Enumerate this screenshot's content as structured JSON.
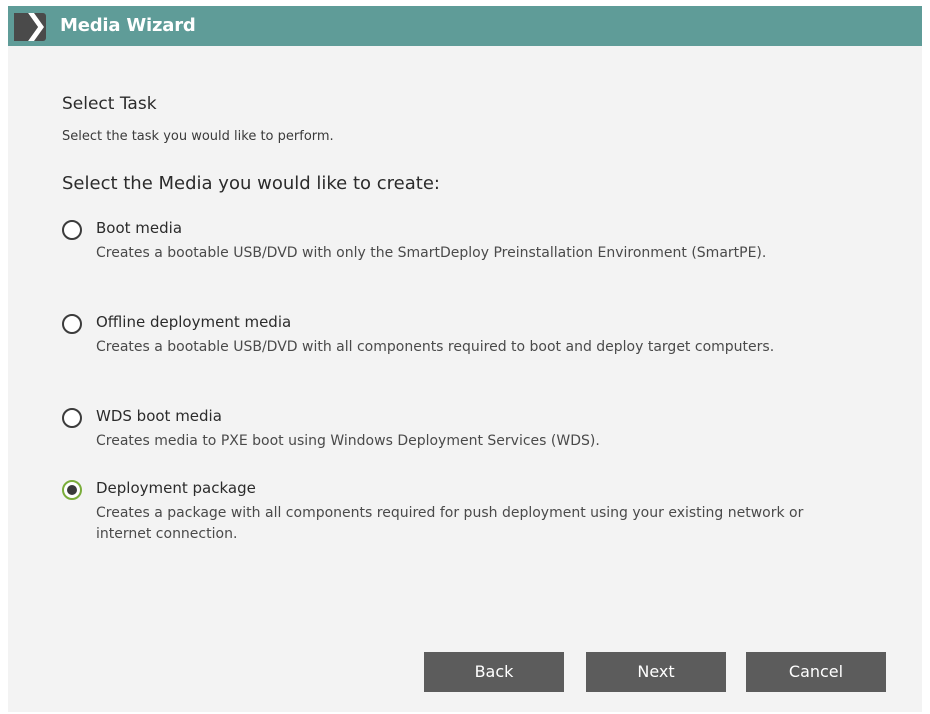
{
  "window": {
    "title": "Media Wizard",
    "logo_icon": "chevron-right-logo-icon"
  },
  "page": {
    "heading": "Select Task",
    "subheading": "Select the task you would like to perform.",
    "prompt": "Select the Media you would like to create:"
  },
  "options": [
    {
      "label": "Boot media",
      "description": "Creates a bootable USB/DVD with only the SmartDeploy Preinstallation Environment (SmartPE).",
      "selected": false
    },
    {
      "label": "Offline deployment media",
      "description": "Creates a bootable USB/DVD with all components required to boot and deploy target computers.",
      "selected": false
    },
    {
      "label": "WDS boot media",
      "description": "Creates media to PXE boot using Windows Deployment Services (WDS).",
      "selected": false
    },
    {
      "label": "Deployment package",
      "description": "Creates a package with all components required for push deployment using your existing network or internet connection.",
      "selected": true
    }
  ],
  "buttons": {
    "back": "Back",
    "next": "Next",
    "cancel": "Cancel"
  },
  "colors": {
    "titlebar": "#5f9c98",
    "button": "#5c5c5c",
    "selected_ring": "#7aad3a",
    "background": "#f3f3f3"
  }
}
